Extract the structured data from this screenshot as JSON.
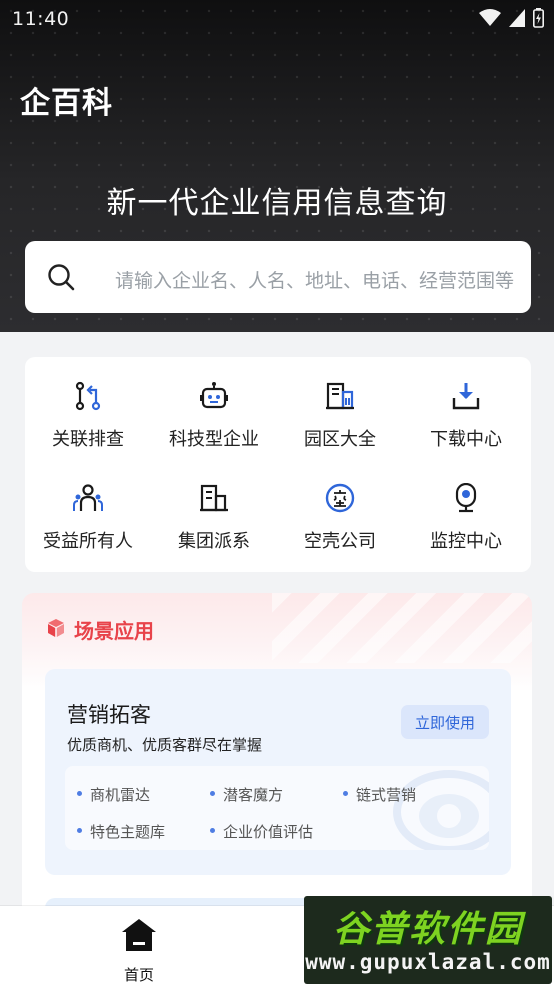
{
  "status_bar": {
    "time": "11:40"
  },
  "header": {
    "brand": "企百科",
    "title": "新一代企业信用信息查询",
    "search_placeholder": "请输入企业名、人名、地址、电话、经营范围等"
  },
  "quick_tools": [
    {
      "label": "关联排查",
      "icon": "relation-check-icon"
    },
    {
      "label": "科技型企业",
      "icon": "robot-icon"
    },
    {
      "label": "园区大全",
      "icon": "building-icon"
    },
    {
      "label": "下载中心",
      "icon": "download-icon"
    },
    {
      "label": "受益所有人",
      "icon": "people-icon"
    },
    {
      "label": "集团派系",
      "icon": "buildings-icon"
    },
    {
      "label": "空壳公司",
      "icon": "shell-company-icon"
    },
    {
      "label": "监控中心",
      "icon": "camera-icon"
    }
  ],
  "scene": {
    "title": "场景应用",
    "card": {
      "title": "营销拓客",
      "subtitle": "优质商机、优质客群尽在掌握",
      "button": "立即使用",
      "items": [
        "商机雷达",
        "潜客魔方",
        "链式营销",
        "特色主题库",
        "企业价值评估"
      ]
    }
  },
  "bottom_nav": {
    "home_label": "首页"
  },
  "watermark": {
    "title": "谷普软件园",
    "url": "www.gupuxlazal.com"
  },
  "colors": {
    "accent_blue": "#2f66d9",
    "accent_red": "#e8434a",
    "dark_header": "#1c1c1e"
  }
}
